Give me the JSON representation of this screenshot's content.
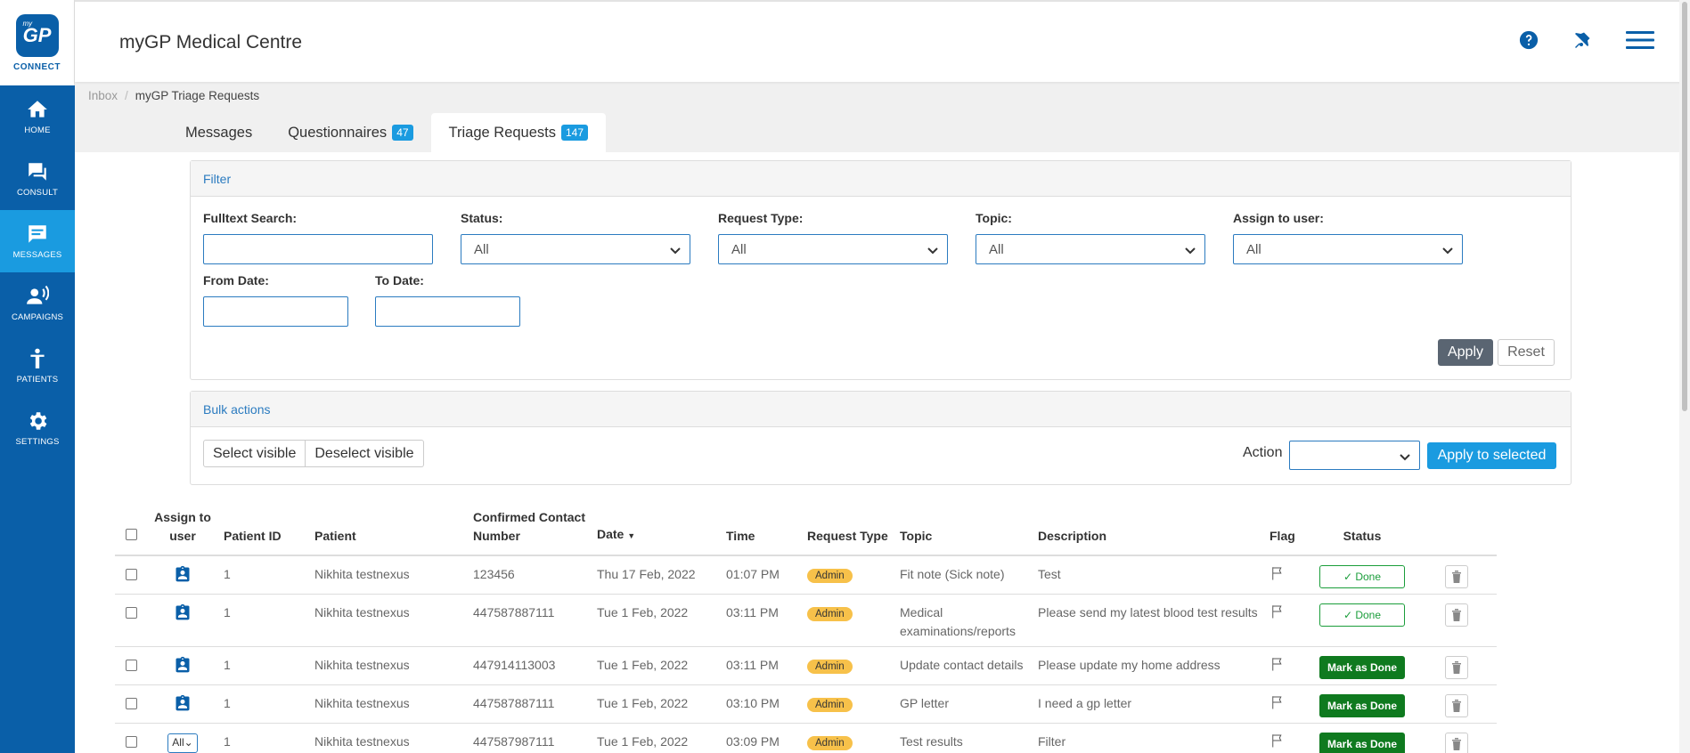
{
  "app": {
    "logo_small": "my",
    "logo_text": "GP",
    "logo_sub": "CONNECT",
    "title": "myGP Medical Centre"
  },
  "colors": {
    "primary": "#0a5fa8",
    "accent": "#1a9be0",
    "admin_badge": "#f7c14a",
    "done": "#1a9d3a",
    "mark_done": "#0f7a1f"
  },
  "sidebar": {
    "items": [
      {
        "label": "HOME",
        "icon": "home-icon"
      },
      {
        "label": "CONSULT",
        "icon": "chat-icon"
      },
      {
        "label": "MESSAGES",
        "icon": "message-icon"
      },
      {
        "label": "CAMPAIGNS",
        "icon": "megaphone-person-icon"
      },
      {
        "label": "PATIENTS",
        "icon": "person-icon"
      },
      {
        "label": "SETTINGS",
        "icon": "gear-icon"
      }
    ]
  },
  "header": {
    "icons": [
      "help-icon",
      "bell-icon",
      "menu-icon"
    ]
  },
  "breadcrumb": {
    "root": "Inbox",
    "sep": "/",
    "current": "myGP Triage Requests"
  },
  "tabs": [
    {
      "label": "Messages",
      "count": ""
    },
    {
      "label": "Questionnaires",
      "count": "47"
    },
    {
      "label": "Triage Requests",
      "count": "147"
    }
  ],
  "filter": {
    "title": "Filter",
    "fulltext_label": "Fulltext Search:",
    "status_label": "Status:",
    "status_value": "All",
    "request_type_label": "Request Type:",
    "request_type_value": "All",
    "topic_label": "Topic:",
    "topic_value": "All",
    "assign_label": "Assign to user:",
    "assign_value": "All",
    "from_label": "From Date:",
    "to_label": "To Date:",
    "apply": "Apply",
    "reset": "Reset"
  },
  "bulk": {
    "title": "Bulk actions",
    "select_visible": "Select visible",
    "deselect_visible": "Deselect visible",
    "action_label": "Action",
    "action_value": "",
    "apply_selected": "Apply to selected"
  },
  "table": {
    "headers": {
      "assign": "Assign to user",
      "patient_id": "Patient ID",
      "patient": "Patient",
      "contact": "Confirmed Contact Number",
      "date": "Date",
      "time": "Time",
      "request_type": "Request Type",
      "topic": "Topic",
      "description": "Description",
      "flag": "Flag",
      "status": "Status"
    },
    "rows": [
      {
        "patient_id": "1",
        "patient": "Nikhita testnexus",
        "contact": "123456",
        "date": "Thu 17 Feb, 2022",
        "time": "01:07 PM",
        "type": "Admin",
        "topic": "Fit note (Sick note)",
        "description": "Test",
        "status": "Done"
      },
      {
        "patient_id": "1",
        "patient": "Nikhita testnexus",
        "contact": "447587887111",
        "date": "Tue 1 Feb, 2022",
        "time": "03:11 PM",
        "type": "Admin",
        "topic": "Medical examinations/reports",
        "description": "Please send my latest blood test results",
        "status": "Done"
      },
      {
        "patient_id": "1",
        "patient": "Nikhita testnexus",
        "contact": "447914113003",
        "date": "Tue 1 Feb, 2022",
        "time": "03:11 PM",
        "type": "Admin",
        "topic": "Update contact details",
        "description": "Please update my home address",
        "status": "Mark as Done"
      },
      {
        "patient_id": "1",
        "patient": "Nikhita testnexus",
        "contact": "447587887111",
        "date": "Tue 1 Feb, 2022",
        "time": "03:10 PM",
        "type": "Admin",
        "topic": "GP letter",
        "description": "I need a gp letter",
        "status": "Mark as Done"
      },
      {
        "patient_id": "1",
        "patient": "Nikhita testnexus",
        "contact": "447587987111",
        "date": "Tue 1 Feb, 2022",
        "time": "03:09 PM",
        "type": "Admin",
        "topic": "Test results",
        "description": "Filter",
        "status": "Mark as Done",
        "assign_select": "All"
      }
    ]
  }
}
